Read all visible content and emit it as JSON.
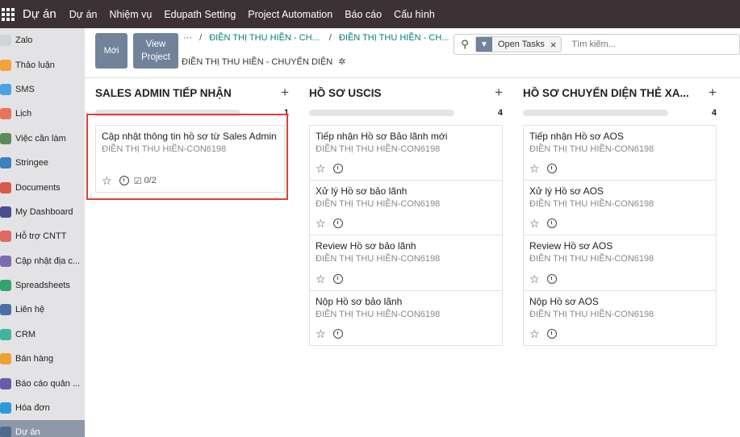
{
  "topbar": {
    "brand": "Dự án",
    "menu": [
      "Dự án",
      "Nhiệm vụ",
      "Edupath Setting",
      "Project Automation",
      "Báo cáo",
      "Cấu hình"
    ]
  },
  "sidebar": {
    "items": [
      {
        "label": "Zalo",
        "color": "#cfd4da"
      },
      {
        "label": "Thảo luận",
        "color": "#f2a33a"
      },
      {
        "label": "SMS",
        "color": "#4aa3df"
      },
      {
        "label": "Lịch",
        "color": "#e8745a"
      },
      {
        "label": "Việc cần làm",
        "color": "#5b8a5b"
      },
      {
        "label": "Stringee",
        "color": "#3c7fc2"
      },
      {
        "label": "Documents",
        "color": "#d95a4a"
      },
      {
        "label": "My Dashboard",
        "color": "#4b4f8f"
      },
      {
        "label": "Hỗ trợ CNTT",
        "color": "#e06a5f"
      },
      {
        "label": "Cập nhật địa c...",
        "color": "#7d6bb0"
      },
      {
        "label": "Spreadsheets",
        "color": "#35a46b"
      },
      {
        "label": "Liên hệ",
        "color": "#4a6fa8"
      },
      {
        "label": "CRM",
        "color": "#3fb5a0"
      },
      {
        "label": "Bán hàng",
        "color": "#f0a030"
      },
      {
        "label": "Báo cáo quản ...",
        "color": "#6c5aa8"
      },
      {
        "label": "Hóa đơn",
        "color": "#2d9ad6"
      },
      {
        "label": "Dự án",
        "color": "#4e6a8f"
      }
    ]
  },
  "control": {
    "new_label": "Mới",
    "view_project_label": "View Project",
    "crumb_ellipsis": "···",
    "crumb_1": "ĐIỀN THỊ THU HIỀN - CH...",
    "crumb_2": "ĐIỀN THỊ THU HIỀN - CH...",
    "current": "ĐIỀN THỊ THU HIỀN - CHUYỂN DIỆN",
    "facet_label": "Open Tasks",
    "search_placeholder": "Tìm kiếm..."
  },
  "columns": [
    {
      "title": "SALES ADMIN TIẾP NHẬN",
      "count": "1",
      "cards": [
        {
          "title": "Cập nhật thông tin hồ sơ từ Sales Admin",
          "sub": "ĐIỀN THỊ THU HIỀN-CON6198",
          "checklist": "0/2"
        }
      ]
    },
    {
      "title": "HỒ SƠ USCIS",
      "count": "4",
      "cards": [
        {
          "title": "Tiếp nhận Hồ sơ Bảo lãnh mới",
          "sub": "ĐIỀN THỊ THU HIỀN-CON6198"
        },
        {
          "title": "Xử lý Hồ sơ bảo lãnh",
          "sub": "ĐIỀN THỊ THU HIỀN-CON6198"
        },
        {
          "title": "Review Hồ sơ bảo lãnh",
          "sub": "ĐIỀN THỊ THU HIỀN-CON6198"
        },
        {
          "title": "Nộp Hồ sơ bảo lãnh",
          "sub": "ĐIỀN THỊ THU HIỀN-CON6198"
        }
      ]
    },
    {
      "title": "HỒ SƠ CHUYỂN DIỆN THẺ XA...",
      "count": "4",
      "cards": [
        {
          "title": "Tiếp nhận Hồ sơ AOS",
          "sub": "ĐIỀN THỊ THU HIỀN-CON6198"
        },
        {
          "title": "Xử lý Hồ sơ AOS",
          "sub": "ĐIỀN THỊ THU HIỀN-CON6198"
        },
        {
          "title": "Review Hồ sơ AOS",
          "sub": "ĐIỀN THỊ THU HIỀN-CON6198"
        },
        {
          "title": "Nộp Hồ sơ AOS",
          "sub": "ĐIỀN THỊ THU HIỀN-CON6198"
        }
      ]
    }
  ],
  "colors": {
    "highlight": "#e53d32",
    "navbar": "#3c3235",
    "primary": "#71839b"
  }
}
